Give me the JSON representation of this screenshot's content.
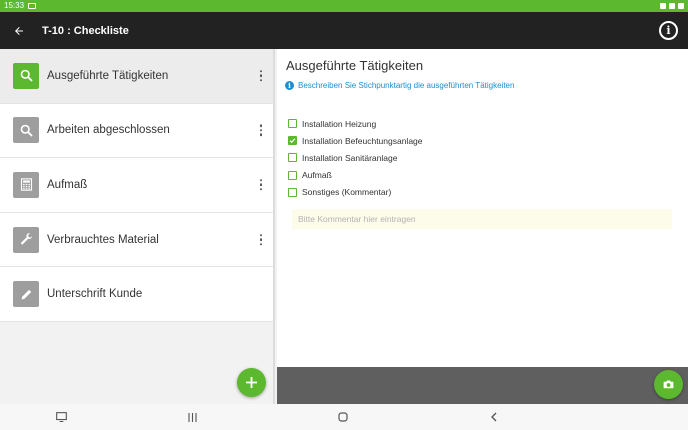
{
  "status_bar": {
    "time": "15:33"
  },
  "app_bar": {
    "title": "T-10 : Checkliste"
  },
  "sidebar": {
    "items": [
      {
        "label": "Ausgeführte Tätigkeiten",
        "icon": "search-icon",
        "active": true
      },
      {
        "label": "Arbeiten abgeschlossen",
        "icon": "search-icon",
        "active": false
      },
      {
        "label": "Aufmaß",
        "icon": "calculator-icon",
        "active": false
      },
      {
        "label": "Verbrauchtes Material",
        "icon": "wrench-icon",
        "active": false
      },
      {
        "label": "Unterschrift Kunde",
        "icon": "pencil-icon",
        "active": false
      }
    ]
  },
  "detail": {
    "title": "Ausgeführte Tätigkeiten",
    "hint": "Beschreiben Sie Stichpunktartig die ausgeführten Tätigkeiten",
    "checklist": [
      {
        "label": "Installation Heizung",
        "checked": false
      },
      {
        "label": "Installation Befeuchtungsanlage",
        "checked": true
      },
      {
        "label": "Installation Sanitäranlage",
        "checked": false
      },
      {
        "label": "Aufmaß",
        "checked": false
      },
      {
        "label": "Sonstiges (Kommentar)",
        "checked": false
      }
    ],
    "comment_placeholder": "Bitte Kommentar hier eintragen"
  },
  "colors": {
    "accent": "#5cb82e",
    "appbar": "#222222",
    "hint": "#1a8fd0"
  }
}
